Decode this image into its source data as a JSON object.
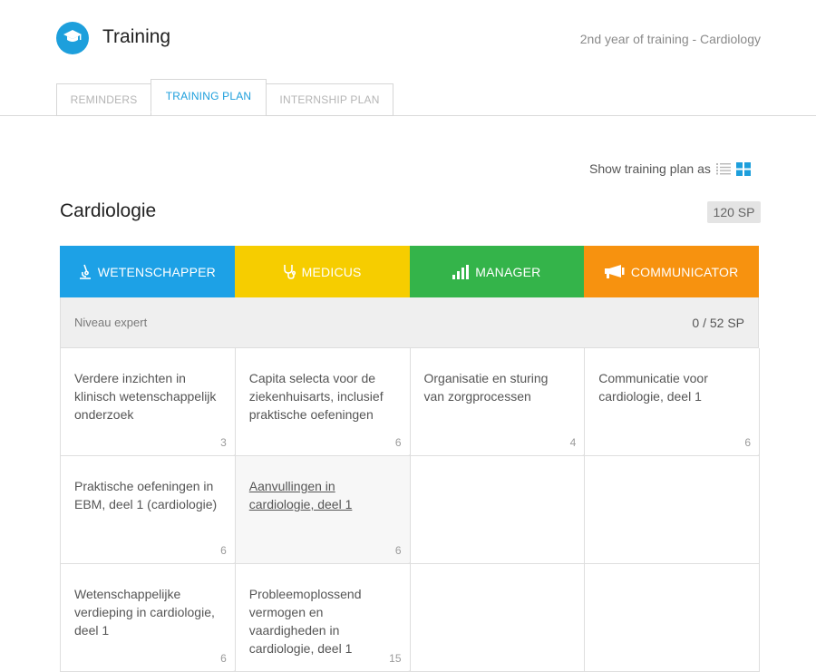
{
  "header": {
    "app_title": "Training",
    "subtitle": "2nd year of training - Cardiology",
    "logo_icon": "graduation-cap-icon",
    "accent": "#1d9fdc"
  },
  "tabs": [
    {
      "label": "REMINDERS",
      "active": false
    },
    {
      "label": "TRAINING PLAN",
      "active": true
    },
    {
      "label": "INTERNSHIP PLAN",
      "active": false
    }
  ],
  "view_toggle": {
    "label": "Show training plan as",
    "options": [
      "list-icon",
      "grid-icon"
    ],
    "selected": "grid-icon"
  },
  "section": {
    "title": "Cardiologie",
    "total_sp": "120 SP"
  },
  "roles": [
    {
      "label": "WETENSCHAPPER",
      "color": "#1da1e6",
      "icon": "microscope-icon"
    },
    {
      "label": "MEDICUS",
      "color": "#f6cd00",
      "icon": "stethoscope-icon"
    },
    {
      "label": "MANAGER",
      "color": "#34b44a",
      "icon": "bar-chart-icon"
    },
    {
      "label": "COMMUNICATOR",
      "color": "#f7920f",
      "icon": "megaphone-icon"
    }
  ],
  "level": {
    "label": "Niveau expert",
    "sp": "0 / 52 SP"
  },
  "rows": [
    [
      {
        "text": "Verdere inzichten in klinisch wetenschappelijk onderzoek",
        "sp": "3"
      },
      {
        "text": "Capita selecta voor de ziekenhuisarts, inclusief praktische oefeningen",
        "sp": "6"
      },
      {
        "text": "Organisatie en sturing van zorgprocessen",
        "sp": "4"
      },
      {
        "text": "Communicatie voor cardiologie, deel 1",
        "sp": "6"
      }
    ],
    [
      {
        "text": "Praktische oefeningen in EBM, deel 1 (cardiologie)",
        "sp": "6"
      },
      {
        "text": "Aanvullingen in cardiologie, deel 1",
        "sp": "6"
      },
      {
        "text": "",
        "sp": ""
      },
      {
        "text": "",
        "sp": ""
      }
    ],
    [
      {
        "text": "Wetenschappelijke verdieping in cardiologie, deel 1",
        "sp": "6"
      },
      {
        "text": "Probleemoplossend vermogen en vaardigheden in cardiologie, deel 1",
        "sp": "15"
      },
      {
        "text": "",
        "sp": ""
      },
      {
        "text": "",
        "sp": ""
      }
    ]
  ]
}
